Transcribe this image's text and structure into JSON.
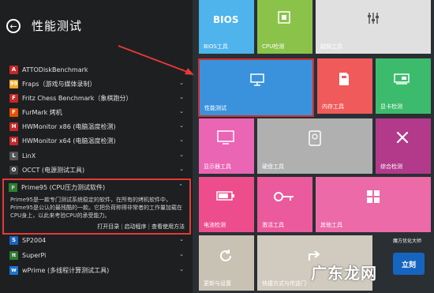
{
  "header": {
    "title": "性能测试",
    "back_icon": "←"
  },
  "software_list": [
    {
      "name": "ATTODiskBenchmark",
      "icon_color": "#c62828",
      "icon_text": "A"
    },
    {
      "name": "Fraps（游戏与媒体录制）",
      "icon_color": "#f9a825",
      "icon_text": "99"
    },
    {
      "name": "Fritz Chess Benchmark（象棋跑分）",
      "icon_color": "#c62828",
      "icon_text": "F"
    },
    {
      "name": "FurMark 烤机",
      "icon_color": "#e65100",
      "icon_text": "F"
    },
    {
      "name": "HWMonitor x86 (电脑温度检测)",
      "icon_color": "#c62828",
      "icon_text": "H"
    },
    {
      "name": "HWMonitor x64 (电脑温度检测)",
      "icon_color": "#c62828",
      "icon_text": "H"
    },
    {
      "name": "LinX",
      "icon_color": "#555555",
      "icon_text": "L"
    },
    {
      "name": "OCCT (电源测试工具)",
      "icon_color": "#424242",
      "icon_text": "O"
    }
  ],
  "expanded_item": {
    "name": "Prime95 (CPU压力测试软件)",
    "description": "Prime95是一款专门测试系统稳定的软件，在所有的烤机软件中，Prime95是公认的最残酷的一款。它把负荷称得非常者的工作量加载在CPU身上，以此来考验CPU的承受能力。",
    "links": [
      "打开目录",
      "启动程序",
      "查看使用方法"
    ]
  },
  "software_list_after": [
    {
      "name": "SP2004",
      "icon_color": "#1565c0",
      "icon_text": "S"
    },
    {
      "name": "SuperPi",
      "icon_color": "#2e7d32",
      "icon_text": "π"
    },
    {
      "name": "wPrime (多线程计算测试工具)",
      "icon_color": "#1976d2",
      "icon_text": "w"
    }
  ],
  "tiles": {
    "bios": {
      "label": "BIOS工具",
      "big": "BIOS",
      "color": "#4fb3ec"
    },
    "cpu": {
      "label": "CPU检测",
      "color": "#8bc34a"
    },
    "overclock": {
      "label": "超频工具",
      "color": "#e0e0e0"
    },
    "perf": {
      "label": "性能测试",
      "color": "#3a92dc"
    },
    "memory": {
      "label": "内存工具",
      "color": "#f05a5a"
    },
    "gpu": {
      "label": "显卡检测",
      "color": "#3dbb6d"
    },
    "display": {
      "label": "显示器工具",
      "color": "#ea65b4"
    },
    "disk": {
      "label": "硬盘工具",
      "color": "#b0b0b0"
    },
    "general": {
      "label": "综合检测",
      "color": "#b33a8a"
    },
    "battery": {
      "label": "电池检测",
      "color": "#ed4d8d"
    },
    "activate": {
      "label": "激活工具",
      "color": "#ea5a9c"
    },
    "other": {
      "label": "其他工具",
      "color": "#ec6aa8"
    },
    "update": {
      "label": "更新与设置",
      "color": "#c9c2b4"
    },
    "shortcut": {
      "label": "快捷方式与传送门",
      "color": "#d1cbbf"
    }
  },
  "watermark": {
    "text": "广东龙网",
    "logo": "立刻",
    "small": "魔方优化大师"
  }
}
